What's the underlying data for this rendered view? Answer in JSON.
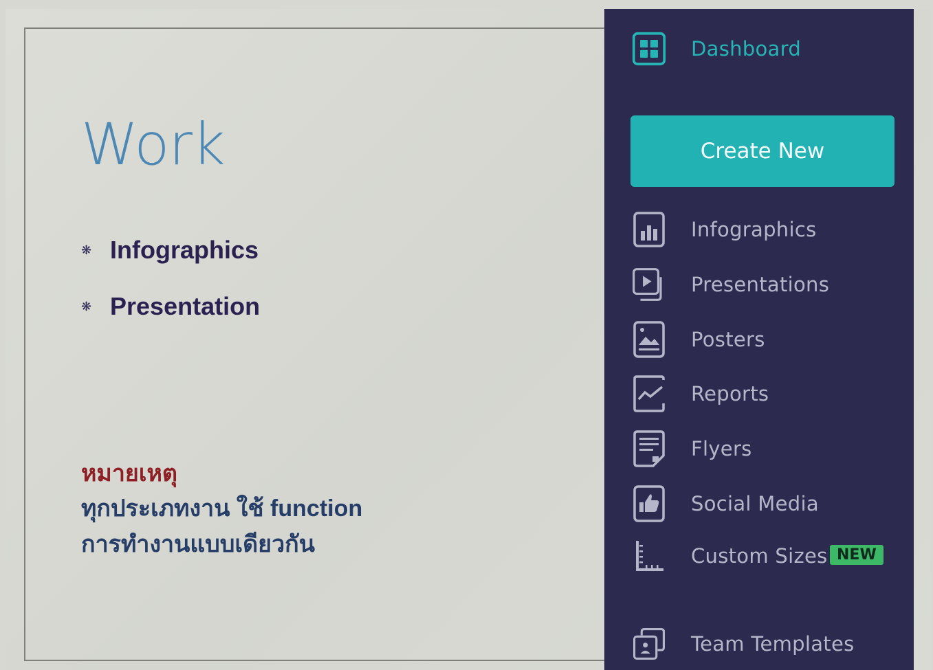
{
  "slide": {
    "title": "Work",
    "bullets": [
      {
        "icon": "asterisk-bullet-icon",
        "text": "Infographics"
      },
      {
        "icon": "asterisk-bullet-icon",
        "text": "Presentation"
      }
    ],
    "note": {
      "title": "หมายเหตุ",
      "line1": "ทุกประเภทงาน ใช้ function",
      "line2": "การทำงานแบบเดียวกัน"
    }
  },
  "sidebar": {
    "dashboard": {
      "label": "Dashboard",
      "icon": "dashboard-grid-icon"
    },
    "create_new": "Create New",
    "items": [
      {
        "label": "Infographics",
        "icon": "bar-chart-icon"
      },
      {
        "label": "Presentations",
        "icon": "play-slides-icon"
      },
      {
        "label": "Posters",
        "icon": "image-poster-icon"
      },
      {
        "label": "Reports",
        "icon": "line-chart-icon"
      },
      {
        "label": "Flyers",
        "icon": "document-icon"
      },
      {
        "label": "Social Media",
        "icon": "thumbs-up-icon"
      },
      {
        "label": "Custom Sizes",
        "icon": "ruler-icon",
        "badge": "NEW"
      },
      {
        "label": "Team Templates",
        "icon": "team-templates-icon"
      }
    ]
  },
  "colors": {
    "accent": "#23b2b3",
    "sidebar_bg": "#2c2b4f",
    "title": "#4d88b4",
    "note_title": "#8e1f24",
    "badge": "#3db866"
  }
}
